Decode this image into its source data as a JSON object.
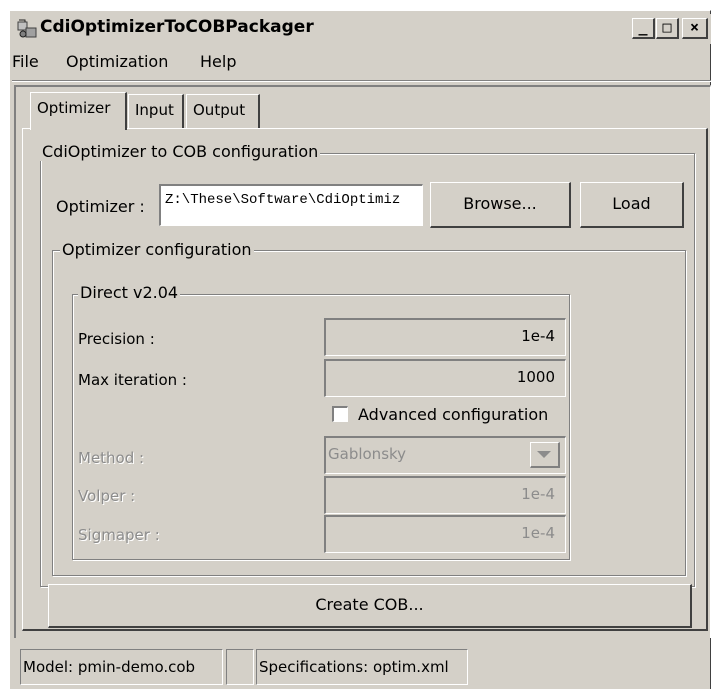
{
  "window": {
    "title": "CdiOptimizerToCOBPackager",
    "controls": {
      "minimize": "_",
      "maximize": "□",
      "close": "×"
    }
  },
  "menu": [
    "File",
    "Optimization",
    "Help"
  ],
  "tabs": [
    {
      "label": "Optimizer",
      "active": true
    },
    {
      "label": "Input",
      "active": false
    },
    {
      "label": "Output",
      "active": false
    }
  ],
  "config_group": {
    "title": "CdiOptimizer to COB configuration",
    "optimizer_label": "Optimizer :",
    "optimizer_path": "Z:\\These\\Software\\CdiOptimiz",
    "browse_label": "Browse...",
    "load_label": "Load"
  },
  "optimizer_config": {
    "title": "Optimizer configuration",
    "direct": {
      "title": "Direct v2.04",
      "precision_label": "Precision :",
      "precision_value": "1e-4",
      "max_iteration_label": "Max iteration :",
      "max_iteration_value": "1000",
      "advanced_label": "Advanced configuration",
      "advanced_checked": false,
      "method_label": "Method :",
      "method_value": "Gablonsky",
      "volper_label": "Volper :",
      "volper_value": "1e-4",
      "sigmaper_label": "Sigmaper :",
      "sigmaper_value": "1e-4"
    }
  },
  "create_cob_label": "Create COB...",
  "status": {
    "model": "Model: pmin-demo.cob",
    "middle": "",
    "specifications": "Specifications: optim.xml"
  },
  "colors": {
    "face": "#d4d0c8",
    "shadow": "#808080",
    "highlight": "#ffffff",
    "disabled_text": "#8c8c8c"
  }
}
